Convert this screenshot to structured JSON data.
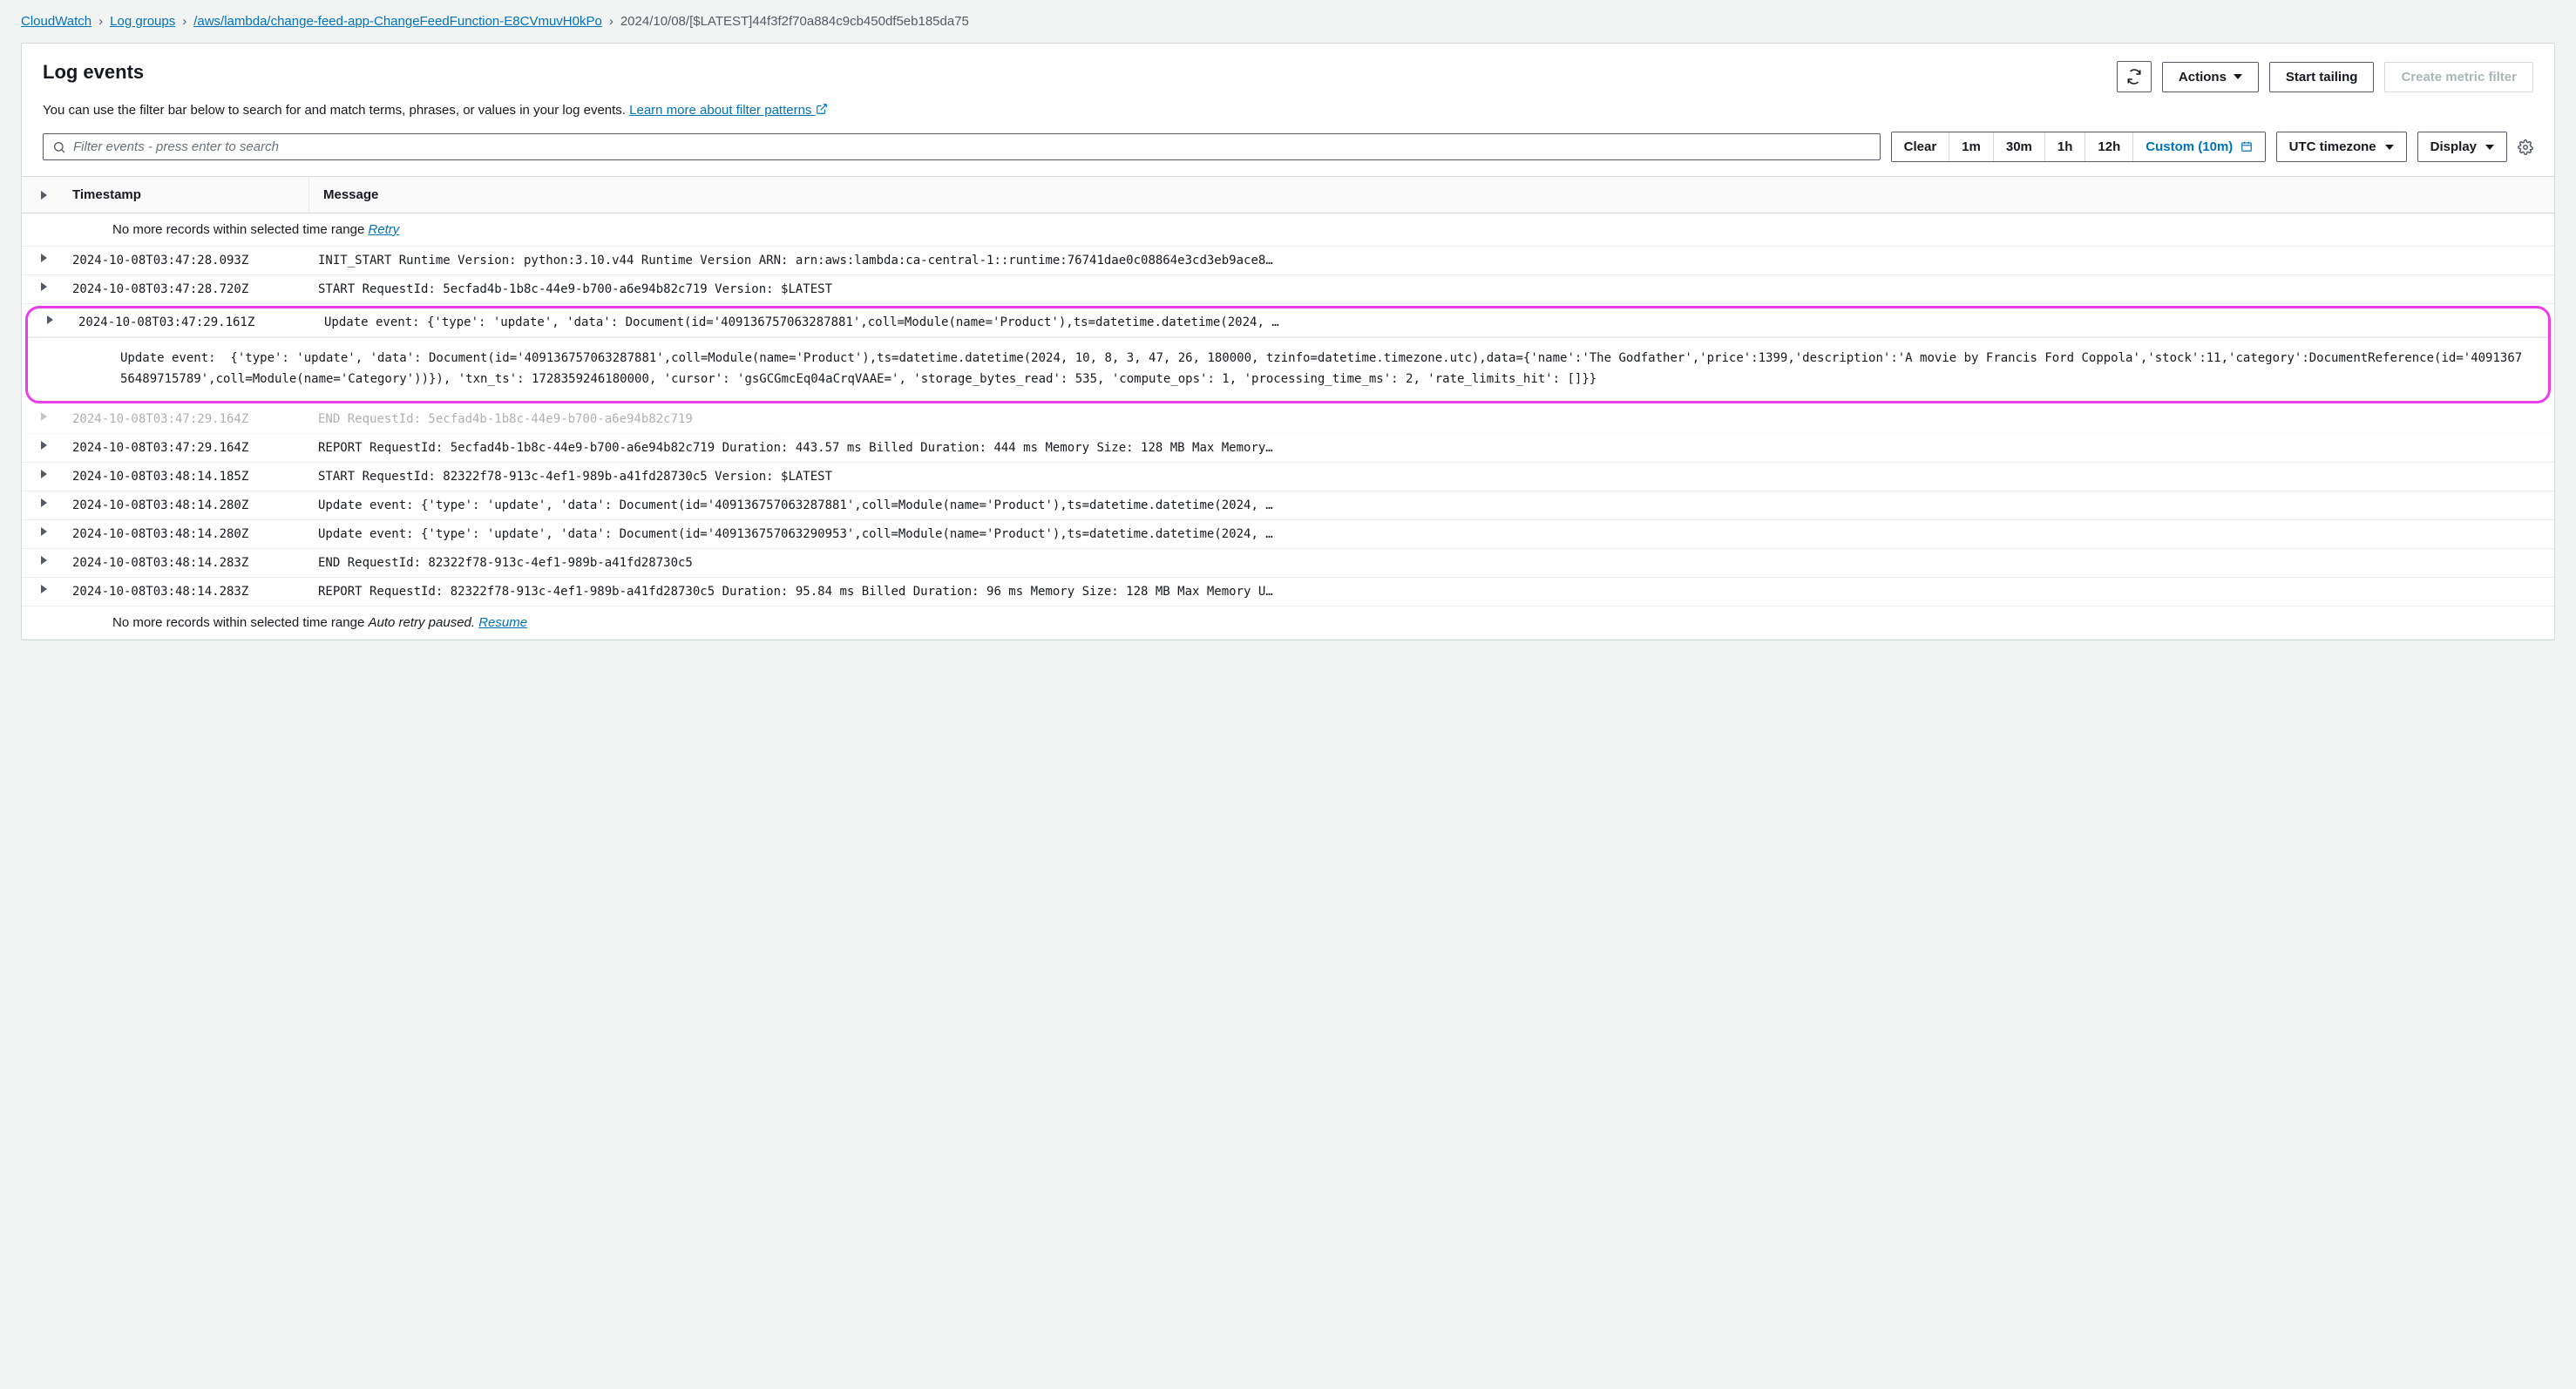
{
  "breadcrumb": {
    "root": "CloudWatch",
    "loggroups": "Log groups",
    "loggroup": "/aws/lambda/change-feed-app-ChangeFeedFunction-E8CVmuvH0kPo",
    "stream": "2024/10/08/[$LATEST]44f3f2f70a884c9cb450df5eb185da75"
  },
  "header": {
    "title": "Log events",
    "subtitle_text": "You can use the filter bar below to search for and match terms, phrases, or values in your log events. ",
    "learn_more": "Learn more about filter patterns"
  },
  "buttons": {
    "actions": "Actions",
    "start_tailing": "Start tailing",
    "create_metric_filter": "Create metric filter"
  },
  "filter": {
    "placeholder": "Filter events - press enter to search",
    "clear": "Clear",
    "ranges": {
      "r1m": "1m",
      "r30m": "30m",
      "r1h": "1h",
      "r12h": "12h",
      "custom": "Custom (10m)"
    },
    "tz": "UTC timezone",
    "display": "Display"
  },
  "columns": {
    "ts": "Timestamp",
    "msg": "Message"
  },
  "info_rows": {
    "no_more_top": "No more records within selected time range ",
    "retry": "Retry",
    "no_more_bottom": "No more records within selected time range ",
    "paused": "Auto retry paused.",
    "resume": "Resume"
  },
  "expanded_detail": "Update event:  {'type': 'update', 'data': Document(id='409136757063287881',coll=Module(name='Product'),ts=datetime.datetime(2024, 10, 8, 3, 47, 26, 180000, tzinfo=datetime.timezone.utc),data={'name':'The Godfather','price':1399,'description':'A movie by Francis Ford Coppola','stock':11,'category':DocumentReference(id='409136756489715789',coll=Module(name='Category'))}), 'txn_ts': 1728359246180000, 'cursor': 'gsGCGmcEq04aCrqVAAE=', 'storage_bytes_read': 535, 'compute_ops': 1, 'processing_time_ms': 2, 'rate_limits_hit': []}}",
  "rows": [
    {
      "ts": "2024-10-08T03:47:28.093Z",
      "msg": "INIT_START Runtime Version: python:3.10.v44 Runtime Version ARN: arn:aws:lambda:ca-central-1::runtime:76741dae0c08864e3cd3eb9ace8…"
    },
    {
      "ts": "2024-10-08T03:47:28.720Z",
      "msg": "START RequestId: 5ecfad4b-1b8c-44e9-b700-a6e94b82c719 Version: $LATEST"
    },
    {
      "ts": "2024-10-08T03:47:29.161Z",
      "msg": "Update event: {'type': 'update', 'data': Document(id='409136757063287881',coll=Module(name='Product'),ts=datetime.datetime(2024, …",
      "expanded": true
    },
    {
      "ts": "2024-10-08T03:47:29.164Z",
      "msg": "END RequestId: 5ecfad4b-1b8c-44e9-b700-a6e94b82c719",
      "obscured": true
    },
    {
      "ts": "2024-10-08T03:47:29.164Z",
      "msg": "REPORT RequestId: 5ecfad4b-1b8c-44e9-b700-a6e94b82c719 Duration: 443.57 ms Billed Duration: 444 ms Memory Size: 128 MB Max Memory…"
    },
    {
      "ts": "2024-10-08T03:48:14.185Z",
      "msg": "START RequestId: 82322f78-913c-4ef1-989b-a41fd28730c5 Version: $LATEST"
    },
    {
      "ts": "2024-10-08T03:48:14.280Z",
      "msg": "Update event: {'type': 'update', 'data': Document(id='409136757063287881',coll=Module(name='Product'),ts=datetime.datetime(2024, …"
    },
    {
      "ts": "2024-10-08T03:48:14.280Z",
      "msg": "Update event: {'type': 'update', 'data': Document(id='409136757063290953',coll=Module(name='Product'),ts=datetime.datetime(2024, …"
    },
    {
      "ts": "2024-10-08T03:48:14.283Z",
      "msg": "END RequestId: 82322f78-913c-4ef1-989b-a41fd28730c5"
    },
    {
      "ts": "2024-10-08T03:48:14.283Z",
      "msg": "REPORT RequestId: 82322f78-913c-4ef1-989b-a41fd28730c5 Duration: 95.84 ms Billed Duration: 96 ms Memory Size: 128 MB Max Memory U…"
    }
  ]
}
